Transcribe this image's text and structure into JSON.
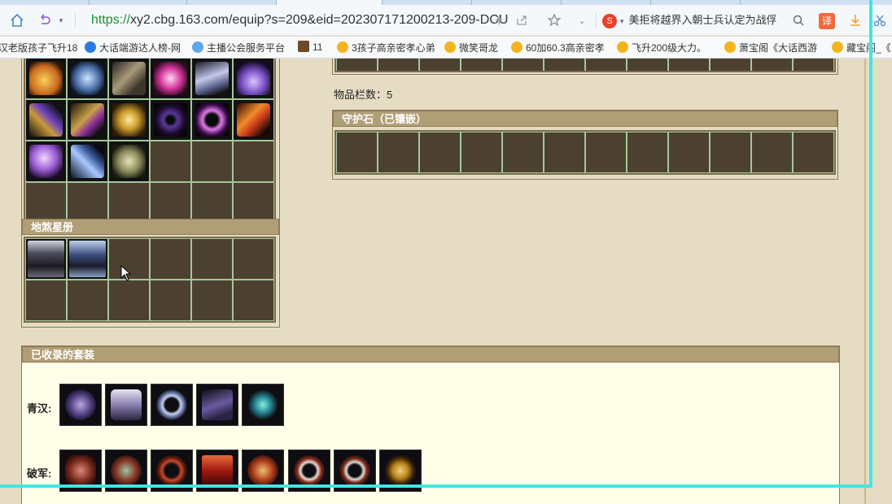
{
  "browser": {
    "url_scheme": "https://",
    "url_rest": "xy2.cbg.163.com/equip?s=209&eid=202307171200213-209-DCU",
    "search_text": "美拒将越界入朝士兵认定为战俘",
    "search_logo": "S",
    "translate_label": "译",
    "icons": [
      "home-icon",
      "undo-icon",
      "lightning-icon",
      "share-icon",
      "star-icon",
      "chevron-down-icon",
      "search-icon",
      "download-icon",
      "scissors-icon"
    ]
  },
  "bookmarks": [
    {
      "label": "汉老版孩子飞升18"
    },
    {
      "label": "大话端游达人榜-网"
    },
    {
      "label": "主播公会服务平台"
    },
    {
      "label": "11"
    },
    {
      "label": "3孩子高亲密孝心弟"
    },
    {
      "label": "微笑哥龙"
    },
    {
      "label": "60加60.3高亲密孝"
    },
    {
      "label": "飞升200级大力。"
    },
    {
      "label": "萧宝阁《大话西游"
    },
    {
      "label": "藏宝阁_《"
    }
  ],
  "page": {
    "item_count_label": "物品栏数：5",
    "guard_stone_title": "守护石（已镶嵌）",
    "star_book_title": "地煞星册",
    "suits_title": "已收录的套装",
    "suits": [
      {
        "label": "青汉:",
        "count": 5
      },
      {
        "label": "破军:",
        "count": 8
      }
    ]
  },
  "colors": {
    "page_bg": "#e6dcc4",
    "panel_title_bg": "#b09e76",
    "slot_bg": "#4c4130",
    "slot_border": "#a3c79a",
    "suits_bg": "#fffee8",
    "selection_frame": "#3fe6e6"
  }
}
